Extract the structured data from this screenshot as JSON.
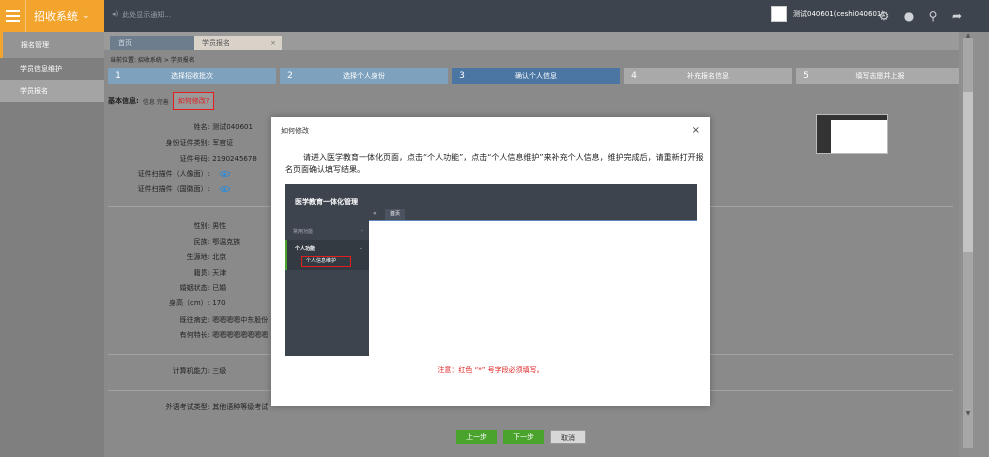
{
  "header": {
    "system_name": "招收系统",
    "notice": "此处显示通知...",
    "user_name": "测试040601(ceshi040601)"
  },
  "sidebar": {
    "head": "报名管理",
    "items": [
      {
        "label": "学员信息维护",
        "active": false
      },
      {
        "label": "学员报名",
        "active": true
      }
    ]
  },
  "tabs": [
    {
      "label": "首页"
    },
    {
      "label": "学员报名",
      "close": "×"
    }
  ],
  "breadcrumb": "当前位置: 招收系统 > 学员报名",
  "steps": [
    {
      "num": "1",
      "label": "选择招收批次",
      "state": "done"
    },
    {
      "num": "2",
      "label": "选择个人身份",
      "state": "done"
    },
    {
      "num": "3",
      "label": "确认个人信息",
      "state": "current"
    },
    {
      "num": "4",
      "label": "补充报名信息",
      "state": "todo"
    },
    {
      "num": "5",
      "label": "填写志愿并上报",
      "state": "todo"
    }
  ],
  "base_info": {
    "label": "基本信息:",
    "hint": "信息 完善",
    "how_link": "如何修改?"
  },
  "fields_top": [
    {
      "key": "姓名:",
      "value": "测试040601"
    },
    {
      "key": "身份证件类别:",
      "value": "军官证"
    },
    {
      "key": "证件号码:",
      "value": "2190245678"
    },
    {
      "key": "证件扫描件（人像面）:",
      "value": ""
    },
    {
      "key": "证件扫描件（国徽面）:",
      "value": ""
    }
  ],
  "fields_mid": [
    {
      "key": "性别:",
      "value": "男性"
    },
    {
      "key": "民族:",
      "value": "鄂温克族"
    },
    {
      "key": "生源地:",
      "value": "北京"
    },
    {
      "key": "籍贯:",
      "value": "天津"
    },
    {
      "key": "婚姻状态:",
      "value": "已婚"
    },
    {
      "key": "身高（cm）:",
      "value": "170"
    },
    {
      "key": "既往病史:",
      "value": "嗯嗯嗯嗯中东股份"
    },
    {
      "key": "有何特长:",
      "value": "嗯嗯嗯嗯嗯嗯嗯嗯"
    }
  ],
  "field_computer": {
    "key": "计算机能力:",
    "value": "三级"
  },
  "field_language": {
    "key": "外语考试类型:",
    "value": "其他语种等级考试"
  },
  "buttons": {
    "prev": "上一步",
    "next": "下一步",
    "cancel": "取消"
  },
  "modal": {
    "title": "如何修改",
    "close": "×",
    "text": "请进入医学教育一体化页面，点击“个人功能”，点击“个人信息维护”来补充个人信息，维护完成后，请重新打开报名页面确认填写结果。",
    "demo": {
      "brand": "医学教育一体化管理",
      "tab": "首页",
      "menu_common": "常用功能",
      "menu_personal": "个人功能",
      "menu_sub": "个人信息维护"
    },
    "note": "注意：红色 “*” 号字段必须填写。"
  }
}
